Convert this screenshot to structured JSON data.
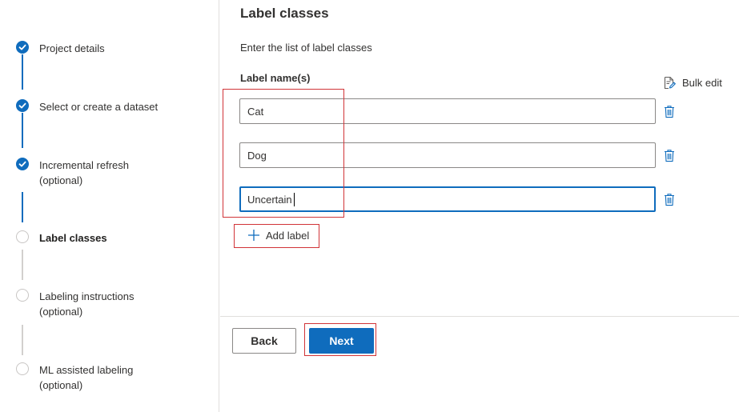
{
  "stepper": {
    "steps": [
      {
        "label": "Project details",
        "state": "done"
      },
      {
        "label": "Select or create a dataset",
        "state": "done"
      },
      {
        "label": "Incremental refresh\n(optional)",
        "state": "done"
      },
      {
        "label": "Label classes",
        "state": "current"
      },
      {
        "label": "Labeling instructions\n(optional)",
        "state": "todo"
      },
      {
        "label": "ML assisted labeling\n(optional)",
        "state": "todo"
      }
    ]
  },
  "main": {
    "title": "Label classes",
    "description": "Enter the list of label classes",
    "field_label": "Label name(s)",
    "bulk_edit_label": "Bulk edit",
    "bulk_edit_icon": "edit-document-icon",
    "labels": [
      "Cat",
      "Dog",
      "Uncertain"
    ],
    "delete_icon": "trash-icon",
    "add_label": "Add label",
    "add_icon": "plus-icon"
  },
  "footer": {
    "back_label": "Back",
    "next_label": "Next"
  },
  "colors": {
    "accent": "#0f6cbd",
    "annotation": "#d13438",
    "step_pending": "#c8c6c4"
  }
}
